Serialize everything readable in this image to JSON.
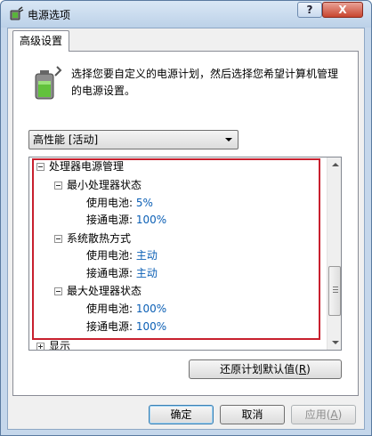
{
  "window": {
    "title": "电源选项",
    "help_label": "?",
    "close_label": "X"
  },
  "tab": {
    "label": "高级设置"
  },
  "description": "选择您要自定义的电源计划，然后选择您希望计算机管理的电源设置。",
  "plan_select": {
    "selected": "高性能 [活动]"
  },
  "tree": {
    "processor": {
      "label": "处理器电源管理",
      "min_state": {
        "label": "最小处理器状态",
        "battery": {
          "label": "使用电池:",
          "value": "5%"
        },
        "plugged": {
          "label": "接通电源:",
          "value": "100%"
        }
      },
      "cooling": {
        "label": "系统散热方式",
        "battery": {
          "label": "使用电池:",
          "value": "主动"
        },
        "plugged": {
          "label": "接通电源:",
          "value": "主动"
        }
      },
      "max_state": {
        "label": "最大处理器状态",
        "battery": {
          "label": "使用电池:",
          "value": "100%"
        },
        "plugged": {
          "label": "接通电源:",
          "value": "100%"
        }
      }
    },
    "display": {
      "label": "显示"
    }
  },
  "buttons": {
    "restore": {
      "label": "还原计划默认值(",
      "key": "R",
      "suffix": ")"
    },
    "ok": {
      "label": "确定"
    },
    "cancel": {
      "label": "取消"
    },
    "apply": {
      "label": "应用(",
      "key": "A",
      "suffix": ")"
    }
  },
  "colors": {
    "highlight_box": "#c8202e",
    "value_text": "#0b5fb5"
  }
}
